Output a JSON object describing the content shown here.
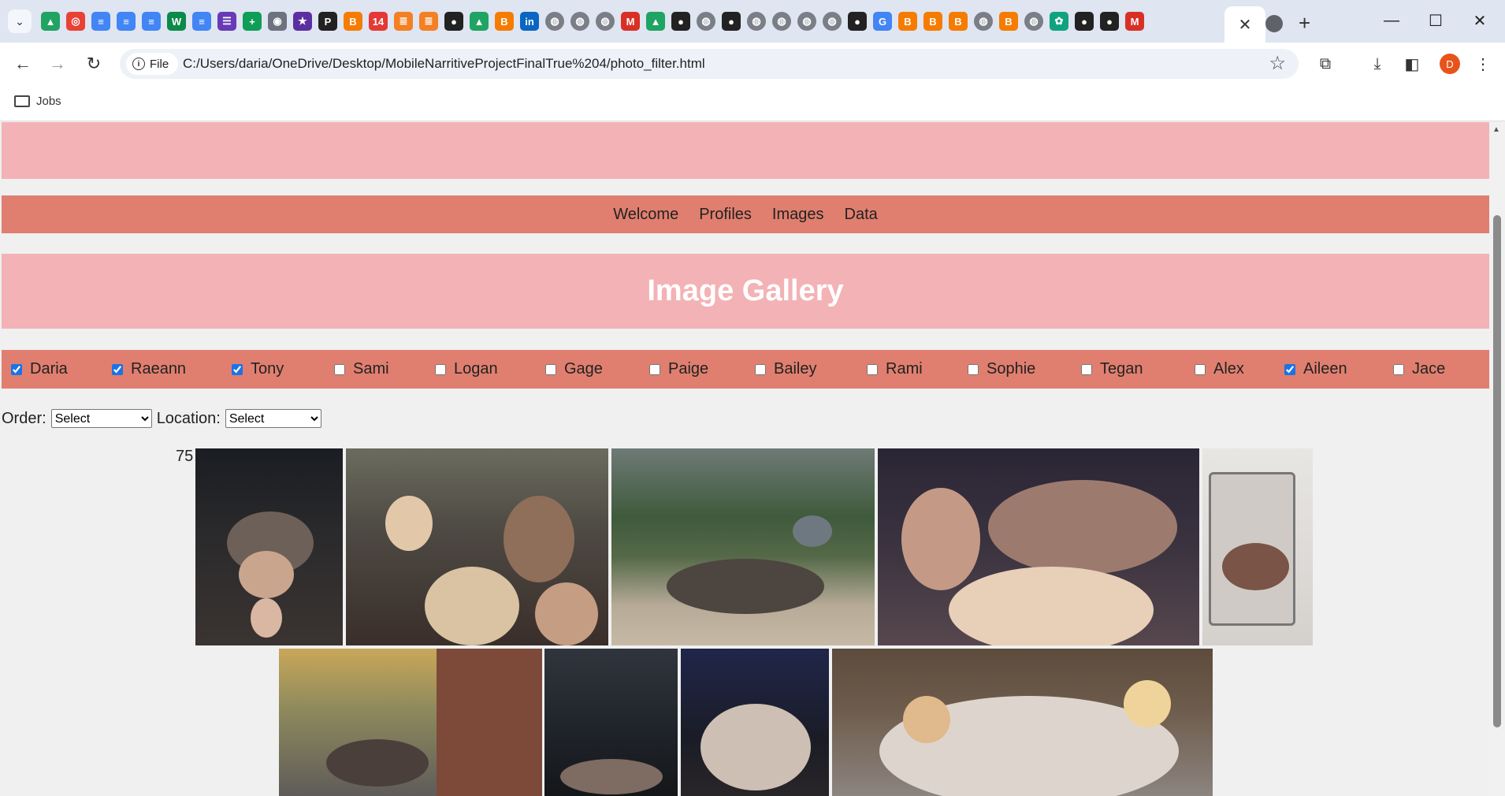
{
  "browser": {
    "url": "C:/Users/daria/OneDrive/Desktop/MobileNarritiveProjectFinalTrue%204/photo_filter.html",
    "chip_label": "File",
    "bookmark_folder": "Jobs",
    "profile_initial": "D",
    "tab_favicons": [
      "drive",
      "target",
      "docs",
      "docs",
      "docs",
      "w",
      "docs",
      "forms",
      "sheets",
      "circle",
      "star",
      "p",
      "b",
      "14",
      "stack",
      "stack",
      "github",
      "drive",
      "b",
      "in",
      "globe",
      "globe",
      "globe",
      "gmail",
      "drive",
      "github",
      "globe",
      "github",
      "globe",
      "globe",
      "globe",
      "globe",
      "github",
      "google",
      "b",
      "b",
      "b",
      "globe",
      "b",
      "globe",
      "gpt",
      "github",
      "github",
      "gmail"
    ]
  },
  "page": {
    "nav": [
      "Welcome",
      "Profiles",
      "Images",
      "Data"
    ],
    "title": "Image Gallery",
    "people": [
      {
        "name": "Daria",
        "checked": true
      },
      {
        "name": "Raeann",
        "checked": true
      },
      {
        "name": "Tony",
        "checked": true
      },
      {
        "name": "Sami",
        "checked": false
      },
      {
        "name": "Logan",
        "checked": false
      },
      {
        "name": "Gage",
        "checked": false
      },
      {
        "name": "Paige",
        "checked": false
      },
      {
        "name": "Bailey",
        "checked": false
      },
      {
        "name": "Rami",
        "checked": false
      },
      {
        "name": "Sophie",
        "checked": false
      },
      {
        "name": "Tegan",
        "checked": false
      },
      {
        "name": "Alex",
        "checked": false
      },
      {
        "name": "Aileen",
        "checked": true
      },
      {
        "name": "Jace",
        "checked": false
      }
    ],
    "order_label": "Order:",
    "order_value": "Select",
    "location_label": "Location:",
    "location_value": "Select",
    "result_count": "75"
  }
}
